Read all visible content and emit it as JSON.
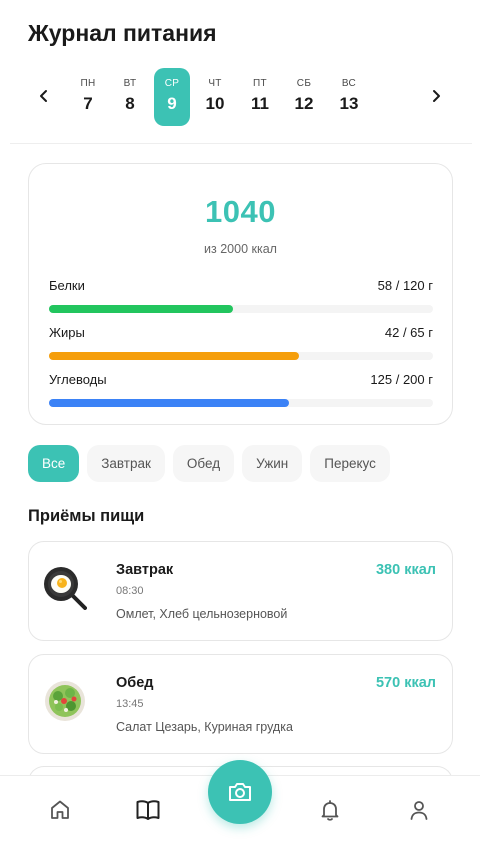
{
  "header": {
    "title": "Журнал питания"
  },
  "week": {
    "days": [
      {
        "dow": "ПН",
        "num": "7"
      },
      {
        "dow": "ВТ",
        "num": "8"
      },
      {
        "dow": "СР",
        "num": "9"
      },
      {
        "dow": "ЧТ",
        "num": "10"
      },
      {
        "dow": "ПТ",
        "num": "11"
      },
      {
        "dow": "СБ",
        "num": "12"
      },
      {
        "dow": "ВС",
        "num": "13"
      }
    ],
    "selected_index": 2
  },
  "summary": {
    "kcal": "1040",
    "goal_text": "из 2000 ккал",
    "macros": [
      {
        "label": "Белки",
        "value": "58 / 120 г",
        "fraction": 0.48,
        "color": "#22c55e"
      },
      {
        "label": "Жиры",
        "value": "42 / 65 г",
        "fraction": 0.65,
        "color": "#f59e0b"
      },
      {
        "label": "Углеводы",
        "value": "125 / 200 г",
        "fraction": 0.625,
        "color": "#3b82f6"
      }
    ]
  },
  "filters": {
    "chips": [
      "Все",
      "Завтрак",
      "Обед",
      "Ужин",
      "Перекус"
    ],
    "active_index": 0
  },
  "meals_section": {
    "title": "Приёмы пищи",
    "meals": [
      {
        "name": "Завтрак",
        "time": "08:30",
        "items": "Омлет, Хлеб цельнозерновой",
        "kcal": "380 ккал",
        "icon": "frying-pan-egg-icon"
      },
      {
        "name": "Обед",
        "time": "13:45",
        "items": "Салат Цезарь, Куриная грудка",
        "kcal": "570 ккал",
        "icon": "salad-bowl-icon"
      }
    ]
  },
  "bottom_nav": {
    "tabs": [
      "home-icon",
      "book-icon",
      "camera-icon",
      "bell-icon",
      "profile-icon"
    ],
    "accent": "#3cc2b4"
  }
}
